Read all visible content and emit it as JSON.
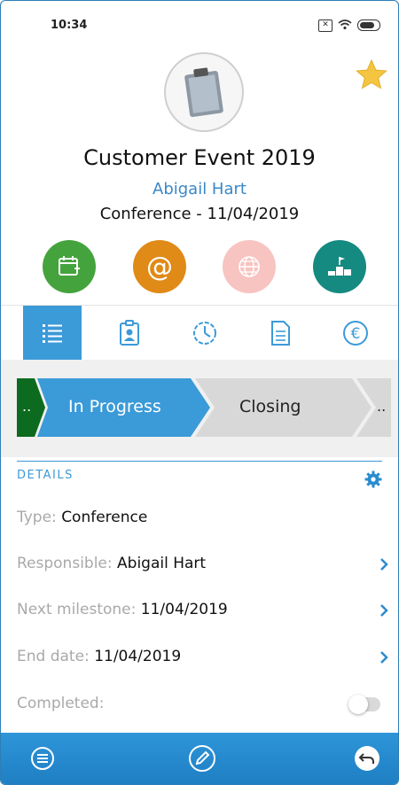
{
  "status_bar": {
    "time": "10:34",
    "sim_icon": "sim-x-icon",
    "wifi_icon": "wifi-icon",
    "battery_icon": "battery-icon"
  },
  "header": {
    "avatar_icon": "clipboard-icon",
    "favorite_icon": "star-icon",
    "favorite_color": "#f5c542",
    "title": "Customer Event 2019",
    "responsible": "Abigail Hart",
    "type_and_date": "Conference - 11/04/2019"
  },
  "actions": [
    {
      "icon": "calendar-add-icon",
      "color": "#45a33e"
    },
    {
      "icon": "at-sign-icon",
      "label": "@",
      "color": "#e08a17"
    },
    {
      "icon": "globe-icon",
      "color": "#f7c4c1"
    },
    {
      "icon": "podium-icon",
      "color": "#158a80"
    }
  ],
  "tabs": [
    {
      "icon": "list-icon",
      "active": true
    },
    {
      "icon": "contact-card-icon",
      "active": false
    },
    {
      "icon": "clock-icon",
      "active": false
    },
    {
      "icon": "document-icon",
      "active": false
    },
    {
      "icon": "euro-icon",
      "active": false
    }
  ],
  "pipeline": {
    "prev_label": "..",
    "current_label": "In Progress",
    "next_label": "Closing",
    "more_label": "..",
    "colors": {
      "done": "#0d6b1f",
      "current": "#3b9ad8",
      "pending": "#d8d8d8"
    }
  },
  "details": {
    "section_label": "DETAILS",
    "settings_icon": "gear-icon",
    "type_key": "Type:",
    "type_value": "Conference",
    "responsible_key": "Responsible:",
    "responsible_value": "Abigail Hart",
    "milestone_key": "Next milestone:",
    "milestone_value": "11/04/2019",
    "end_key": "End date:",
    "end_value": "11/04/2019",
    "completed_key": "Completed:",
    "completed_value": false
  },
  "bottom_bar": {
    "menu_icon": "menu-icon",
    "edit_icon": "edit-icon",
    "back_icon": "undo-icon",
    "color": "#2889cf"
  }
}
